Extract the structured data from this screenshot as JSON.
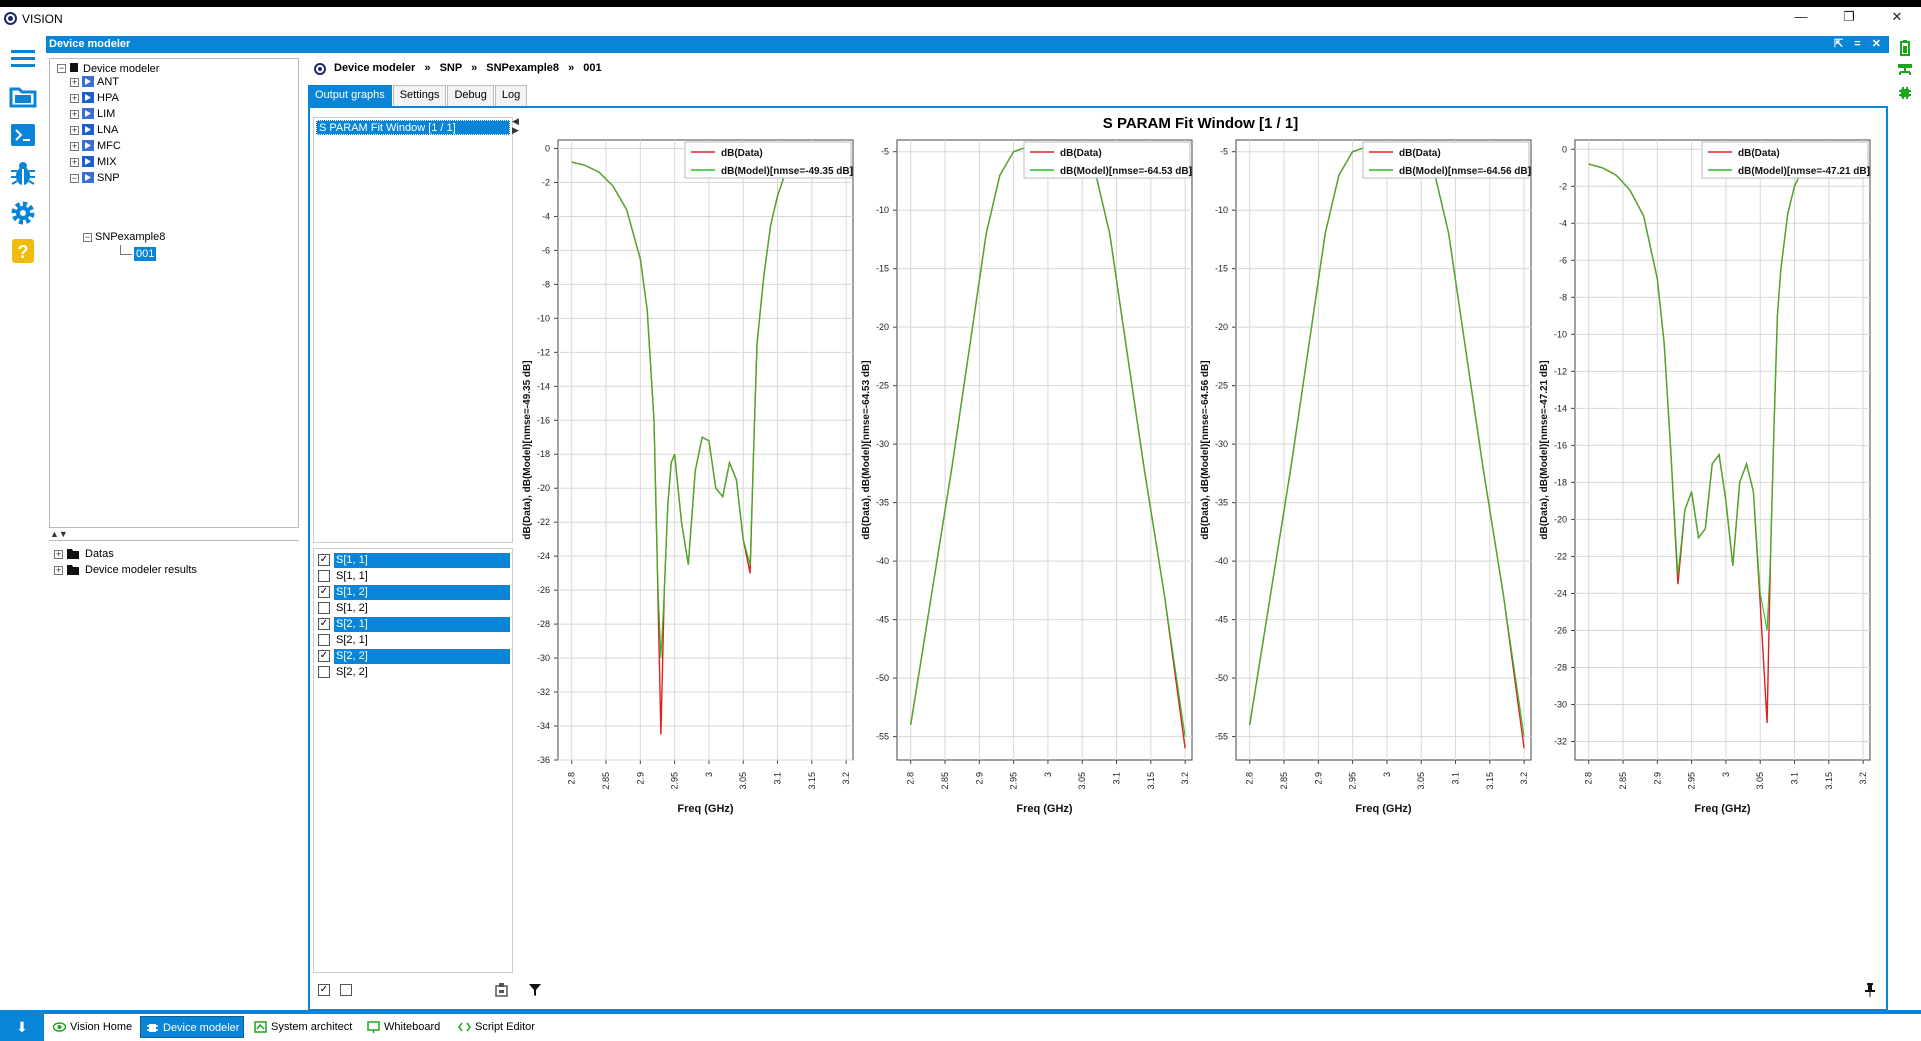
{
  "app": {
    "title": "VISION",
    "window_controls": [
      "—",
      "❐",
      "✕"
    ]
  },
  "module": {
    "title": "Device modeler",
    "header_buttons": "⇱ = ✕"
  },
  "sidebar_icons": [
    "menu-icon",
    "folder-icon",
    "terminal-icon",
    "bug-icon",
    "gear-icon",
    "help-icon"
  ],
  "right_icons": [
    "battery-icon",
    "network-icon",
    "chip-icon"
  ],
  "tree": {
    "root": "Device modeler",
    "items": [
      {
        "label": "ANT",
        "icon_color": "#3a6fd6"
      },
      {
        "label": "HPA",
        "icon_color": "#1a5fd0"
      },
      {
        "label": "LIM",
        "icon_color": "#3a6fd6"
      },
      {
        "label": "LNA",
        "icon_color": "#1a5fd0"
      },
      {
        "label": "MFC",
        "icon_color": "#3a6fd6"
      },
      {
        "label": "MIX",
        "icon_color": "#1a5fd0"
      },
      {
        "label": "SNP",
        "icon_color": "#3a6fd6"
      }
    ],
    "snp_child": "SNPexample8",
    "leaf": "001"
  },
  "bottom_tree": {
    "items": [
      "Datas",
      "Device modeler results"
    ]
  },
  "breadcrumb": {
    "items": [
      "Device modeler",
      "SNP",
      "SNPexample8",
      "001"
    ],
    "separator": "»"
  },
  "tabs": [
    {
      "label": "Output graphs",
      "active": true
    },
    {
      "label": "Settings",
      "active": false
    },
    {
      "label": "Debug",
      "active": false
    },
    {
      "label": "Log",
      "active": false
    }
  ],
  "window_list": {
    "items": [
      "S PARAM Fit Window [1 / 1]"
    ]
  },
  "sparams": [
    {
      "label": "S[1, 1]",
      "checked": true
    },
    {
      "label": "S[1, 1]",
      "checked": false
    },
    {
      "label": "S[1, 2]",
      "checked": true
    },
    {
      "label": "S[1, 2]",
      "checked": false
    },
    {
      "label": "S[2, 1]",
      "checked": true
    },
    {
      "label": "S[2, 1]",
      "checked": false
    },
    {
      "label": "S[2, 2]",
      "checked": true
    },
    {
      "label": "S[2, 2]",
      "checked": false
    }
  ],
  "colors": {
    "accent": "#0a84d6",
    "data_line": "#e02020",
    "model_line": "#22c422"
  },
  "chart_data": [
    {
      "type": "line",
      "title": "S PARAM Fit Window [1 / 1]",
      "xlabel": "Freq (GHz)",
      "ylabel": "dB(Data), dB(Model)[nmse=-49.35 dB]",
      "xlim": [
        2.78,
        3.21
      ],
      "ylim": [
        -36,
        0.5
      ],
      "xticks": [
        "2.8",
        "2.85",
        "2.9",
        "2.95",
        "3",
        "3.05",
        "3.1",
        "3.15",
        "3.2"
      ],
      "yticks": [
        0,
        -2,
        -4,
        -6,
        -8,
        -10,
        -12,
        -14,
        -16,
        -18,
        -20,
        -22,
        -24,
        -26,
        -28,
        -30,
        -32,
        -34,
        -36
      ],
      "legend": [
        "dB(Data)",
        "dB(Model)[nmse=-49.35 dB]"
      ],
      "series": [
        {
          "name": "dB(Data)",
          "x": [
            2.8,
            2.82,
            2.84,
            2.86,
            2.88,
            2.9,
            2.91,
            2.92,
            2.925,
            2.93,
            2.935,
            2.94,
            2.945,
            2.95,
            2.96,
            2.97,
            2.98,
            2.99,
            3.0,
            3.01,
            3.02,
            3.03,
            3.04,
            3.05,
            3.06,
            3.065,
            3.07,
            3.08,
            3.09,
            3.1,
            3.11,
            3.12,
            3.14,
            3.16,
            3.18,
            3.2
          ],
          "y": [
            -0.8,
            -1.0,
            -1.4,
            -2.2,
            -3.6,
            -6.5,
            -9.5,
            -16.0,
            -25.0,
            -34.5,
            -26.0,
            -21.0,
            -18.5,
            -18.0,
            -22.0,
            -24.5,
            -19.0,
            -17.0,
            -17.2,
            -20.0,
            -20.5,
            -18.5,
            -19.5,
            -23.0,
            -25.0,
            -18.0,
            -11.5,
            -7.5,
            -4.5,
            -2.8,
            -1.6,
            -1.1,
            -0.8,
            -0.8,
            -0.8,
            -0.8
          ]
        },
        {
          "name": "dB(Model)[nmse=-49.35 dB]",
          "x": [
            2.8,
            2.82,
            2.84,
            2.86,
            2.88,
            2.9,
            2.91,
            2.92,
            2.925,
            2.93,
            2.935,
            2.94,
            2.945,
            2.95,
            2.96,
            2.97,
            2.98,
            2.99,
            3.0,
            3.01,
            3.02,
            3.03,
            3.04,
            3.05,
            3.06,
            3.065,
            3.07,
            3.08,
            3.09,
            3.1,
            3.11,
            3.12,
            3.14,
            3.16,
            3.18,
            3.2
          ],
          "y": [
            -0.8,
            -1.0,
            -1.4,
            -2.2,
            -3.6,
            -6.5,
            -9.5,
            -16.0,
            -25.0,
            -30.0,
            -26.0,
            -21.0,
            -18.5,
            -18.0,
            -22.0,
            -24.5,
            -19.0,
            -17.0,
            -17.2,
            -20.0,
            -20.5,
            -18.5,
            -19.5,
            -23.0,
            -24.5,
            -18.0,
            -11.5,
            -7.5,
            -4.5,
            -2.8,
            -1.6,
            -1.1,
            -0.8,
            -0.8,
            -0.8,
            -0.8
          ]
        }
      ]
    },
    {
      "type": "line",
      "xlabel": "Freq (GHz)",
      "ylabel": "dB(Data), dB(Model)[nmse=-64.53 dB]",
      "xlim": [
        2.78,
        3.21
      ],
      "ylim": [
        -57,
        -4
      ],
      "xticks": [
        "2.8",
        "2.85",
        "2.9",
        "2.95",
        "3",
        "3.05",
        "3.1",
        "3.15",
        "3.2"
      ],
      "yticks": [
        -5,
        -10,
        -15,
        -20,
        -25,
        -30,
        -35,
        -40,
        -45,
        -50,
        -55
      ],
      "legend": [
        "dB(Data)",
        "dB(Model)[nmse=-64.53 dB]"
      ],
      "series": [
        {
          "name": "dB(Data)",
          "x": [
            2.8,
            2.83,
            2.86,
            2.89,
            2.91,
            2.93,
            2.95,
            2.97,
            3.0,
            3.03,
            3.05,
            3.07,
            3.09,
            3.11,
            3.14,
            3.17,
            3.2
          ],
          "y": [
            -54,
            -43,
            -32,
            -20,
            -12,
            -7,
            -5,
            -4.6,
            -4.5,
            -4.6,
            -5,
            -7,
            -12,
            -20,
            -32,
            -43,
            -56
          ]
        },
        {
          "name": "dB(Model)[nmse=-64.53 dB]",
          "x": [
            2.8,
            2.83,
            2.86,
            2.89,
            2.91,
            2.93,
            2.95,
            2.97,
            3.0,
            3.03,
            3.05,
            3.07,
            3.09,
            3.11,
            3.14,
            3.17,
            3.2
          ],
          "y": [
            -54,
            -43,
            -32,
            -20,
            -12,
            -7,
            -5,
            -4.6,
            -4.5,
            -4.6,
            -5,
            -7,
            -12,
            -20,
            -32,
            -43,
            -55
          ]
        }
      ]
    },
    {
      "type": "line",
      "xlabel": "Freq (GHz)",
      "ylabel": "dB(Data), dB(Model)[nmse=-64.56 dB]",
      "xlim": [
        2.78,
        3.21
      ],
      "ylim": [
        -57,
        -4
      ],
      "xticks": [
        "2.8",
        "2.85",
        "2.9",
        "2.95",
        "3",
        "3.05",
        "3.1",
        "3.15",
        "3.2"
      ],
      "yticks": [
        -5,
        -10,
        -15,
        -20,
        -25,
        -30,
        -35,
        -40,
        -45,
        -50,
        -55
      ],
      "legend": [
        "dB(Data)",
        "dB(Model)[nmse=-64.56 dB]"
      ],
      "series": [
        {
          "name": "dB(Data)",
          "x": [
            2.8,
            2.83,
            2.86,
            2.89,
            2.91,
            2.93,
            2.95,
            2.97,
            3.0,
            3.03,
            3.05,
            3.07,
            3.09,
            3.11,
            3.14,
            3.17,
            3.2
          ],
          "y": [
            -54,
            -43,
            -32,
            -20,
            -12,
            -7,
            -5,
            -4.6,
            -4.5,
            -4.6,
            -5,
            -7,
            -12,
            -20,
            -32,
            -43,
            -56
          ]
        },
        {
          "name": "dB(Model)[nmse=-64.56 dB]",
          "x": [
            2.8,
            2.83,
            2.86,
            2.89,
            2.91,
            2.93,
            2.95,
            2.97,
            3.0,
            3.03,
            3.05,
            3.07,
            3.09,
            3.11,
            3.14,
            3.17,
            3.2
          ],
          "y": [
            -54,
            -43,
            -32,
            -20,
            -12,
            -7,
            -5,
            -4.6,
            -4.5,
            -4.6,
            -5,
            -7,
            -12,
            -20,
            -32,
            -43,
            -55
          ]
        }
      ]
    },
    {
      "type": "line",
      "xlabel": "Freq (GHz)",
      "ylabel": "dB(Data), dB(Model)[nmse=-47.21 dB]",
      "xlim": [
        2.78,
        3.21
      ],
      "ylim": [
        -33,
        0.5
      ],
      "xticks": [
        "2.8",
        "2.85",
        "2.9",
        "2.95",
        "3",
        "3.05",
        "3.1",
        "3.15",
        "3.2"
      ],
      "yticks": [
        0,
        -2,
        -4,
        -6,
        -8,
        -10,
        -12,
        -14,
        -16,
        -18,
        -20,
        -22,
        -24,
        -26,
        -28,
        -30,
        -32
      ],
      "legend": [
        "dB(Data)",
        "dB(Model)[nmse=-47.21 dB]"
      ],
      "series": [
        {
          "name": "dB(Data)",
          "x": [
            2.8,
            2.82,
            2.84,
            2.86,
            2.88,
            2.9,
            2.91,
            2.92,
            2.93,
            2.94,
            2.95,
            2.96,
            2.97,
            2.98,
            2.99,
            3.0,
            3.01,
            3.02,
            3.03,
            3.04,
            3.05,
            3.06,
            3.065,
            3.07,
            3.075,
            3.08,
            3.09,
            3.1,
            3.11,
            3.12,
            3.14,
            3.16,
            3.18,
            3.2
          ],
          "y": [
            -0.8,
            -1.0,
            -1.4,
            -2.2,
            -3.6,
            -7.0,
            -10.5,
            -16.5,
            -23.5,
            -19.5,
            -18.5,
            -21.0,
            -20.5,
            -17.0,
            -16.5,
            -19.0,
            -22.5,
            -18.0,
            -17.0,
            -18.5,
            -24.5,
            -31.0,
            -22.0,
            -15.0,
            -9.0,
            -6.5,
            -3.5,
            -2.0,
            -1.2,
            -0.9,
            -0.8,
            -0.8,
            -0.8,
            -0.8
          ]
        },
        {
          "name": "dB(Model)[nmse=-47.21 dB]",
          "x": [
            2.8,
            2.82,
            2.84,
            2.86,
            2.88,
            2.9,
            2.91,
            2.92,
            2.93,
            2.94,
            2.95,
            2.96,
            2.97,
            2.98,
            2.99,
            3.0,
            3.01,
            3.02,
            3.03,
            3.04,
            3.05,
            3.06,
            3.065,
            3.07,
            3.075,
            3.08,
            3.09,
            3.1,
            3.11,
            3.12,
            3.14,
            3.16,
            3.18,
            3.2
          ],
          "y": [
            -0.8,
            -1.0,
            -1.4,
            -2.2,
            -3.6,
            -7.0,
            -10.5,
            -16.5,
            -23.0,
            -19.5,
            -18.5,
            -21.0,
            -20.5,
            -17.0,
            -16.5,
            -19.0,
            -22.5,
            -18.0,
            -17.0,
            -18.5,
            -24.0,
            -26.0,
            -22.0,
            -15.0,
            -9.0,
            -6.5,
            -3.5,
            -2.0,
            -1.2,
            -0.9,
            -0.8,
            -0.8,
            -0.8,
            -0.8
          ]
        }
      ]
    }
  ],
  "taskbar": {
    "items": [
      {
        "label": "Vision Home",
        "active": false
      },
      {
        "label": "Device modeler",
        "active": true
      },
      {
        "label": "System architect",
        "active": false
      },
      {
        "label": "Whiteboard",
        "active": false
      },
      {
        "label": "Script Editor",
        "active": false
      }
    ]
  }
}
